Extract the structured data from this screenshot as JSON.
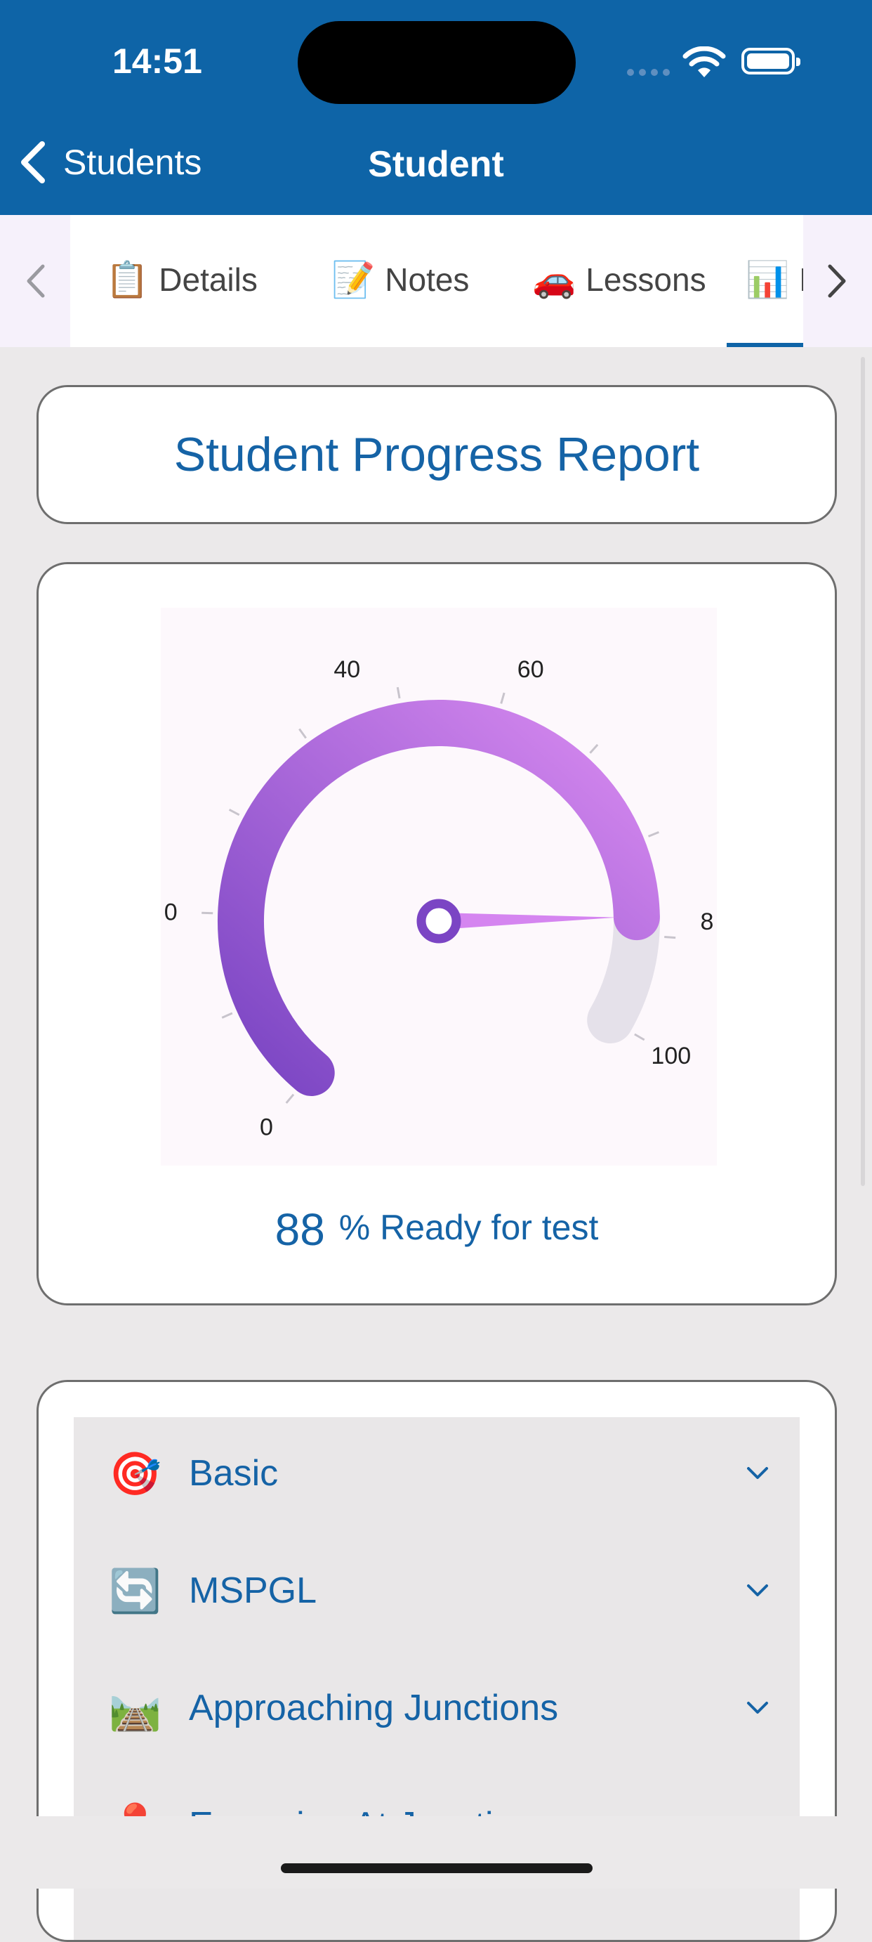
{
  "status_bar": {
    "time": "14:51"
  },
  "nav": {
    "back_label": "Students",
    "title": "Student"
  },
  "tabs": [
    {
      "emoji": "📋",
      "label": "Details"
    },
    {
      "emoji": "📝",
      "label": "Notes"
    },
    {
      "emoji": "🚗",
      "label": "Lessons"
    },
    {
      "emoji": "📊",
      "label": "P"
    }
  ],
  "report": {
    "title": "Student Progress Report"
  },
  "chart_data": {
    "type": "gauge",
    "value": 88,
    "min": 0,
    "max": 100,
    "tick_labels": [
      "0",
      "0",
      "40",
      "60",
      "8",
      "100"
    ],
    "colors": {
      "arc_start": "#7a45c3",
      "arc_end": "#d88af0",
      "remainder": "#e5e1ea",
      "needle": "#d585f0",
      "hub": "#7b45c4"
    }
  },
  "readout": {
    "value": "88",
    "label": "% Ready for test"
  },
  "categories": [
    {
      "icon": "🎯",
      "label": "Basic"
    },
    {
      "icon": "🔄",
      "label": "MSPGL"
    },
    {
      "icon": "🛤️",
      "label": "Approaching Junctions"
    },
    {
      "icon": "📍",
      "label": "Emerging At Junctions"
    }
  ]
}
